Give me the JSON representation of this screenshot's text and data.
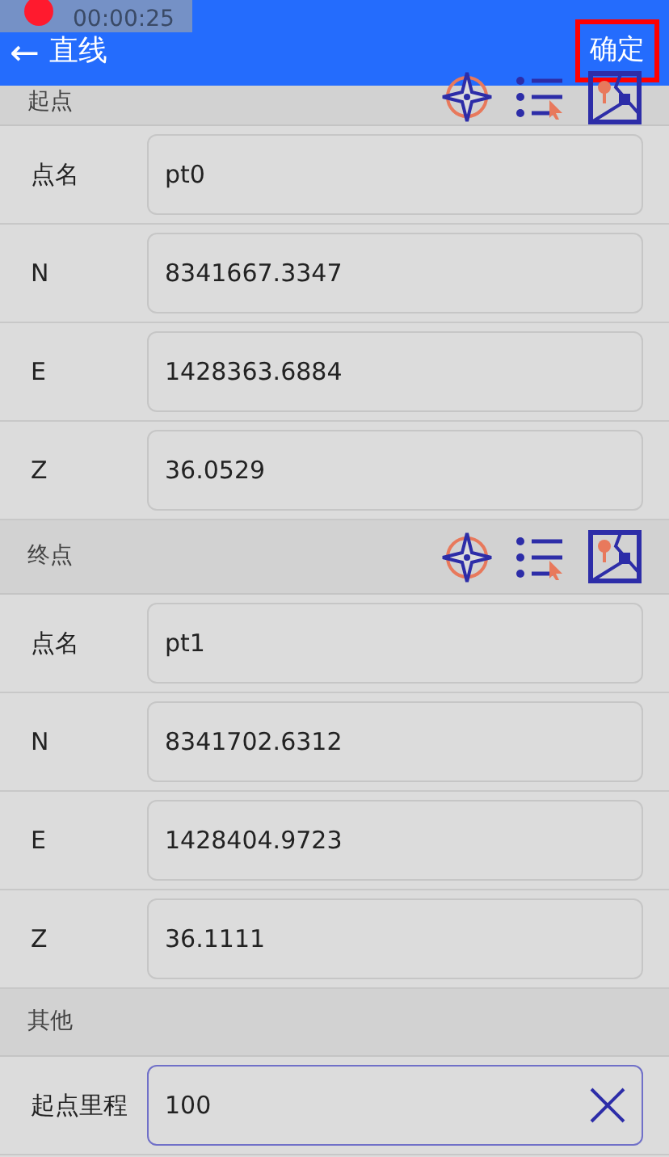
{
  "recorder": {
    "time": "00:00:25"
  },
  "header": {
    "back_icon": "←",
    "title": "直线",
    "confirm": {
      "label": "确定",
      "highlighted": true
    }
  },
  "sections": [
    {
      "title": "起点",
      "tools": true,
      "rows": [
        {
          "label": "点名",
          "value": "pt0",
          "focused": false
        },
        {
          "label": "N",
          "value": "8341667.3347",
          "focused": false
        },
        {
          "label": "E",
          "value": "1428363.6884",
          "focused": false
        },
        {
          "label": "Z",
          "value": "36.0529",
          "focused": false
        }
      ]
    },
    {
      "title": "终点",
      "tools": true,
      "rows": [
        {
          "label": "点名",
          "value": "pt1",
          "focused": false
        },
        {
          "label": "N",
          "value": "8341702.6312",
          "focused": false
        },
        {
          "label": "E",
          "value": "1428404.9723",
          "focused": false
        },
        {
          "label": "Z",
          "value": "36.1111",
          "focused": false
        }
      ]
    },
    {
      "title": "其他",
      "tools": false,
      "rows": [
        {
          "label": "起点里程",
          "value": "100",
          "focused": true
        }
      ]
    }
  ]
}
